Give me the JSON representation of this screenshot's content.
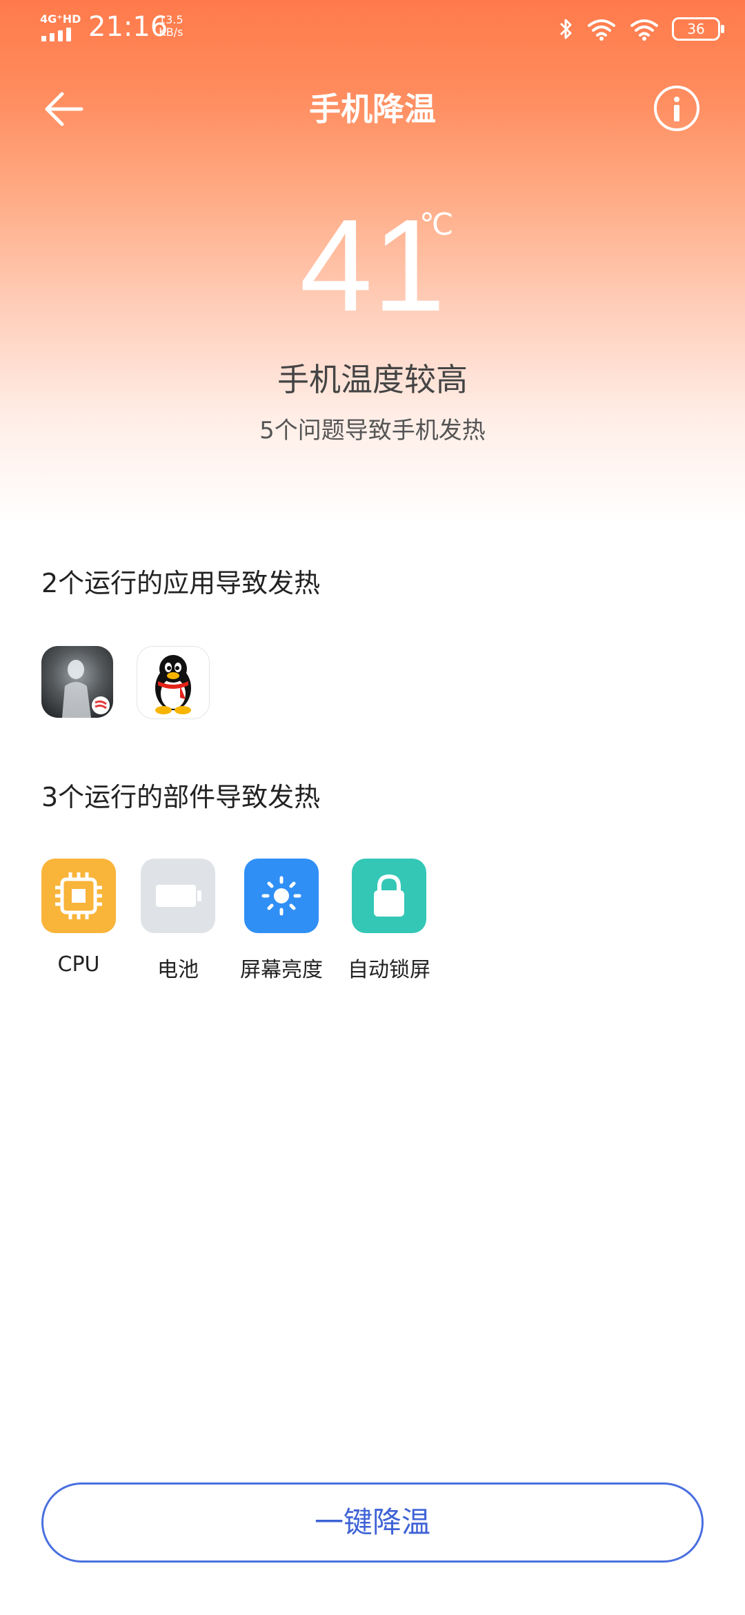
{
  "status_bar": {
    "network": "4G⁺HD",
    "time": "21:16",
    "speed_value": "13.5",
    "speed_unit": "KB/s",
    "battery": "36",
    "icons": [
      "bluetooth-icon",
      "wifi-icon",
      "wifi-plus-icon",
      "battery-icon"
    ]
  },
  "header": {
    "title": "手机降温",
    "back_icon": "arrow-left-icon",
    "info_icon": "info-icon"
  },
  "temperature": {
    "value": "41",
    "unit": "℃",
    "status": "手机温度较高",
    "summary": "5个问题导致手机发热"
  },
  "apps_section": {
    "title": "2个运行的应用导致发热",
    "apps": [
      {
        "icon": "game-app-icon"
      },
      {
        "icon": "qq-penguin-icon"
      }
    ]
  },
  "components_section": {
    "title": "3个运行的部件导致发热",
    "items": [
      {
        "label": "CPU",
        "icon": "cpu-icon",
        "color": "#f9b43a"
      },
      {
        "label": "电池",
        "icon": "battery-icon",
        "color": "#dfe3e8"
      },
      {
        "label": "屏幕亮度",
        "icon": "brightness-icon",
        "color": "#2f8ff5"
      },
      {
        "label": "自动锁屏",
        "icon": "lock-icon",
        "color": "#34c7b6"
      }
    ]
  },
  "action": {
    "button_label": "一键降温",
    "accent": "#3f63d6"
  }
}
